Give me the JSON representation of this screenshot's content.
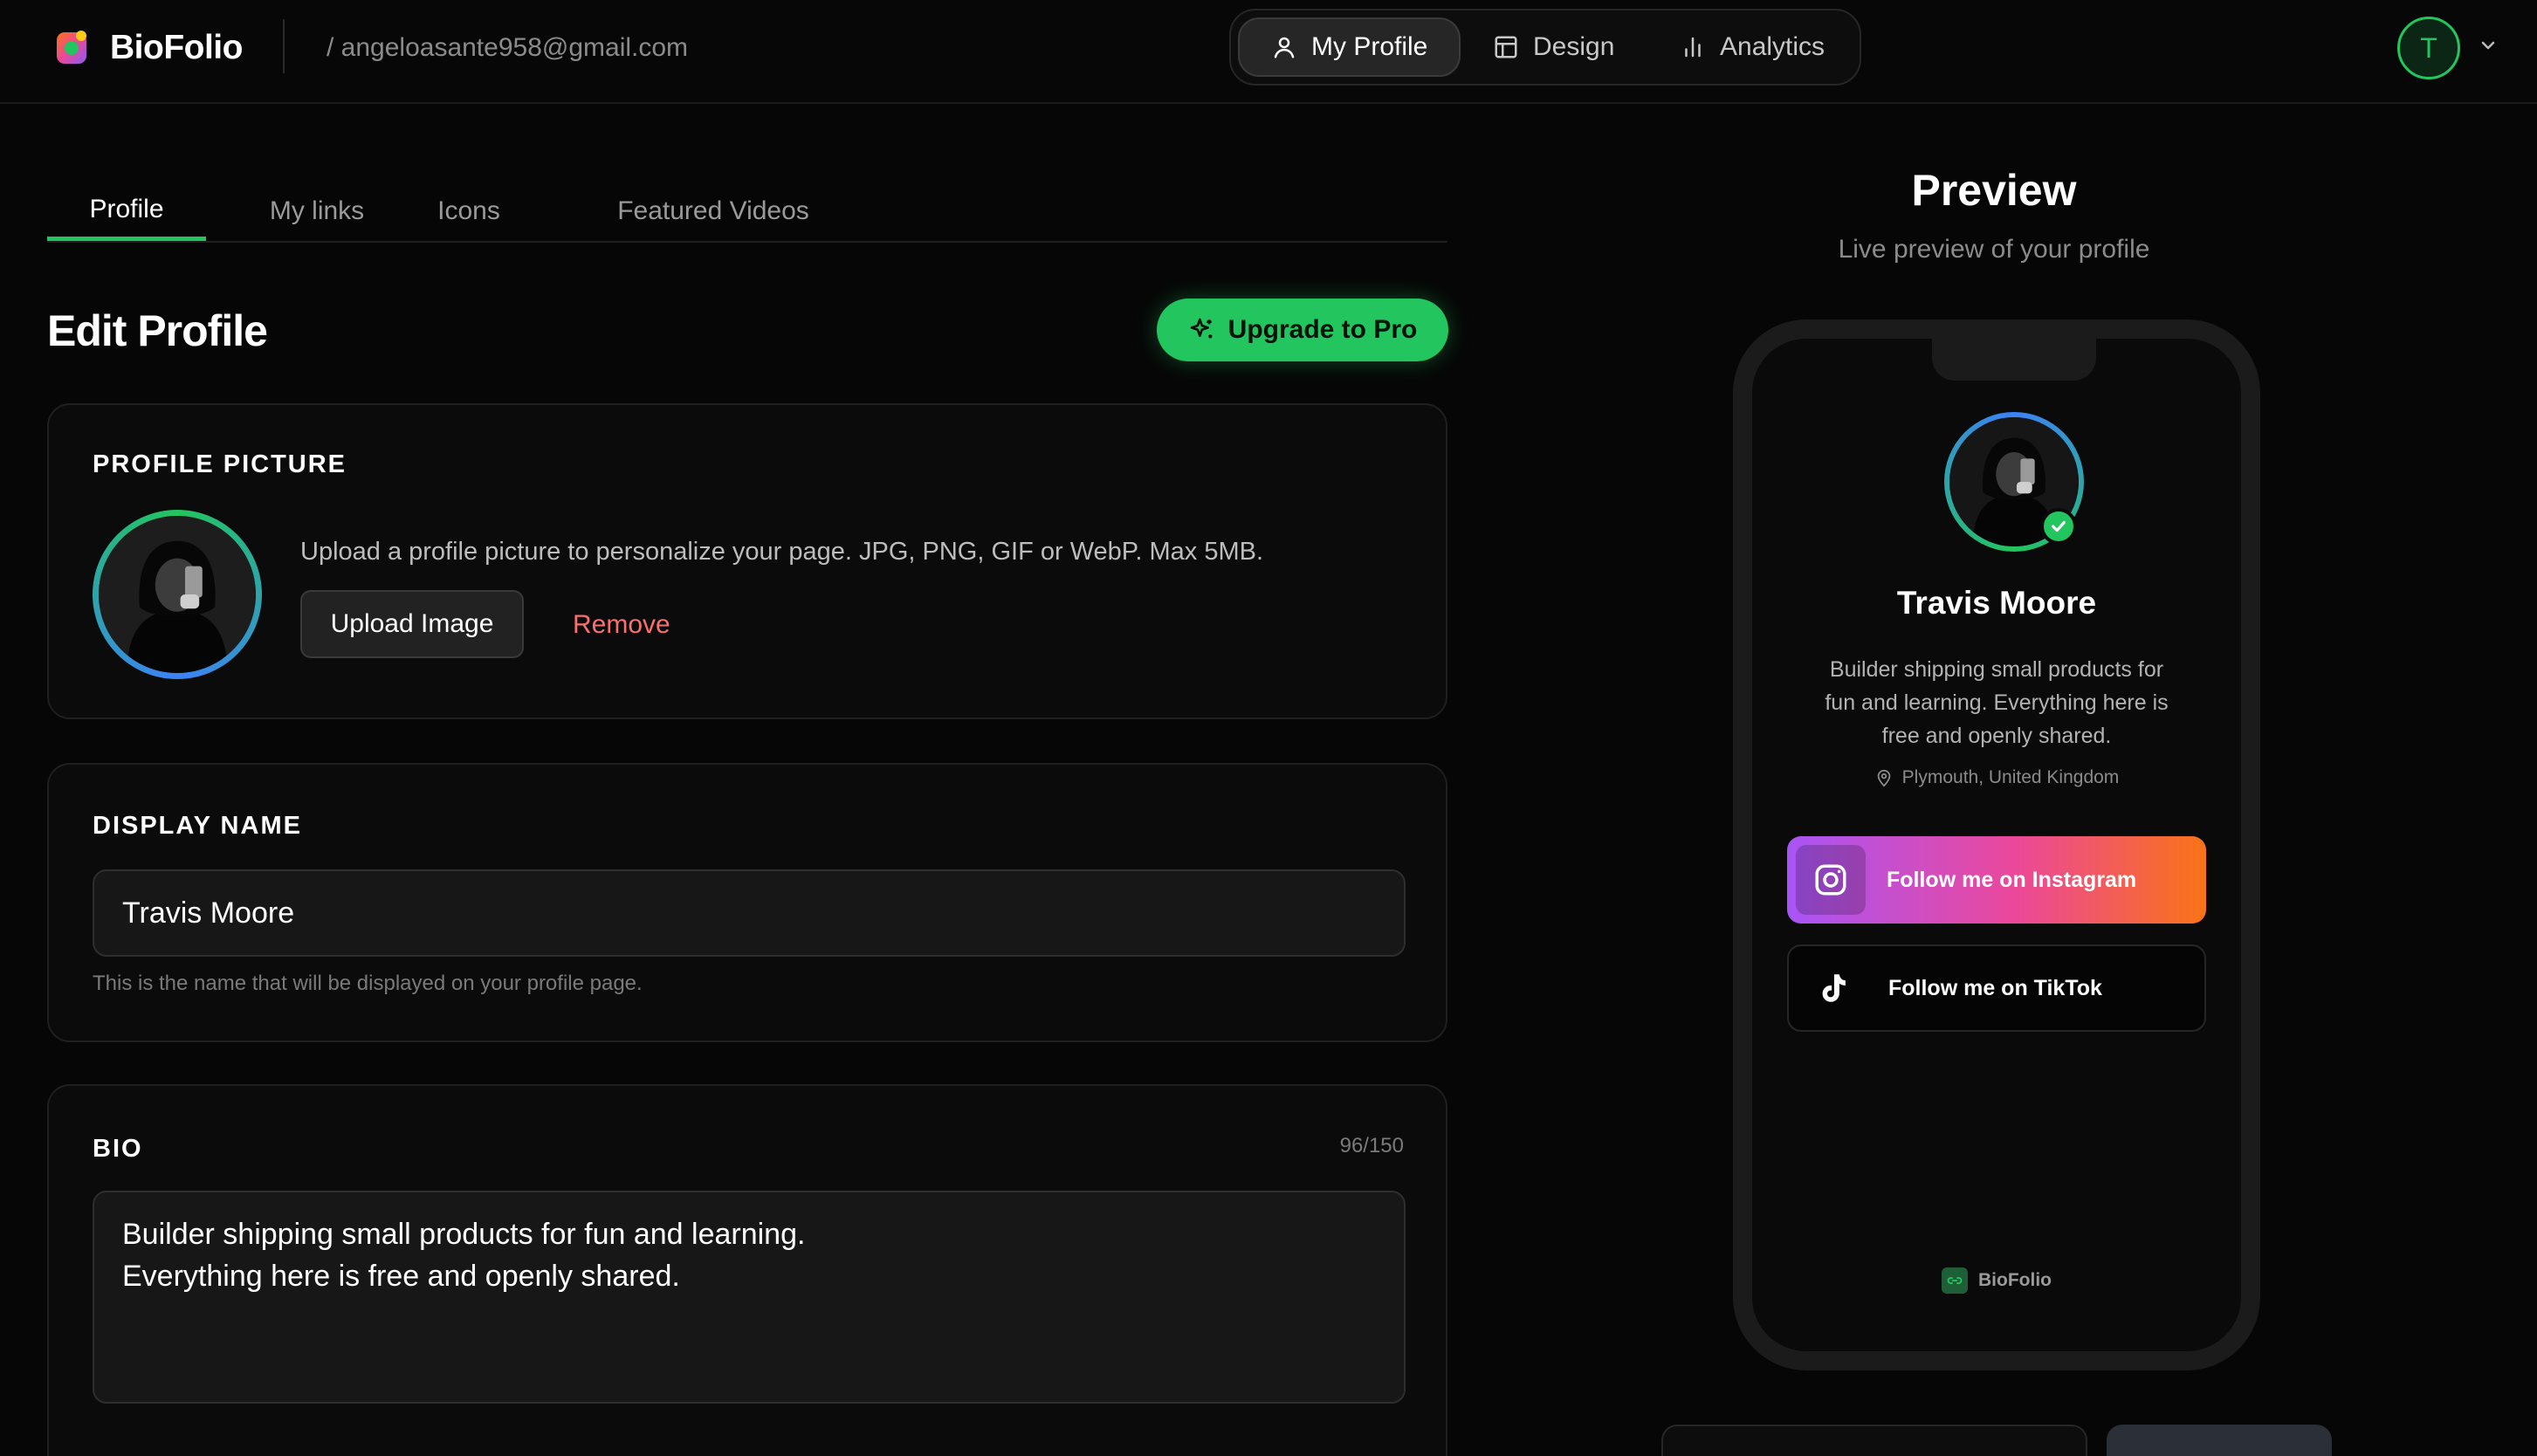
{
  "brand": {
    "name": "BioFolio",
    "logo_icon": "biofolio-logo-icon",
    "accent": "#22c55e"
  },
  "header": {
    "email": "/ angeloasante958@gmail.com",
    "nav": [
      {
        "label": "My Profile",
        "icon": "user-icon",
        "active": true
      },
      {
        "label": "Design",
        "icon": "layout-icon",
        "active": false
      },
      {
        "label": "Analytics",
        "icon": "bar-chart-icon",
        "active": false
      }
    ],
    "avatar_initial": "T"
  },
  "tabs": [
    {
      "label": "Profile",
      "active": true
    },
    {
      "label": "My links",
      "active": false
    },
    {
      "label": "Icons",
      "active": false
    },
    {
      "label": "Featured Videos",
      "active": false
    }
  ],
  "editor": {
    "title": "Edit Profile",
    "upgrade_label": "Upgrade to Pro",
    "profile_picture": {
      "title": "PROFILE PICTURE",
      "description": "Upload a profile picture to personalize your page. JPG, PNG, GIF or WebP. Max 5MB.",
      "upload_label": "Upload Image",
      "remove_label": "Remove"
    },
    "display_name": {
      "title": "DISPLAY NAME",
      "value": "Travis Moore",
      "hint": "This is the name that will be displayed on your profile page."
    },
    "bio": {
      "title": "BIO",
      "counter": "96/150",
      "value": "Builder shipping small products for fun and learning.\nEverything here is free and openly shared."
    }
  },
  "preview": {
    "title": "Preview",
    "subtitle": "Live preview of your profile",
    "name": "Travis Moore",
    "bio": "Builder shipping small products for fun and learning. Everything here is free and openly shared.",
    "location": "Plymouth, United Kingdom",
    "links": [
      {
        "label": "Follow me on Instagram",
        "icon": "instagram-icon"
      },
      {
        "label": "Follow me on TikTok",
        "icon": "tiktok-icon"
      }
    ],
    "footer_brand": "BioFolio"
  }
}
